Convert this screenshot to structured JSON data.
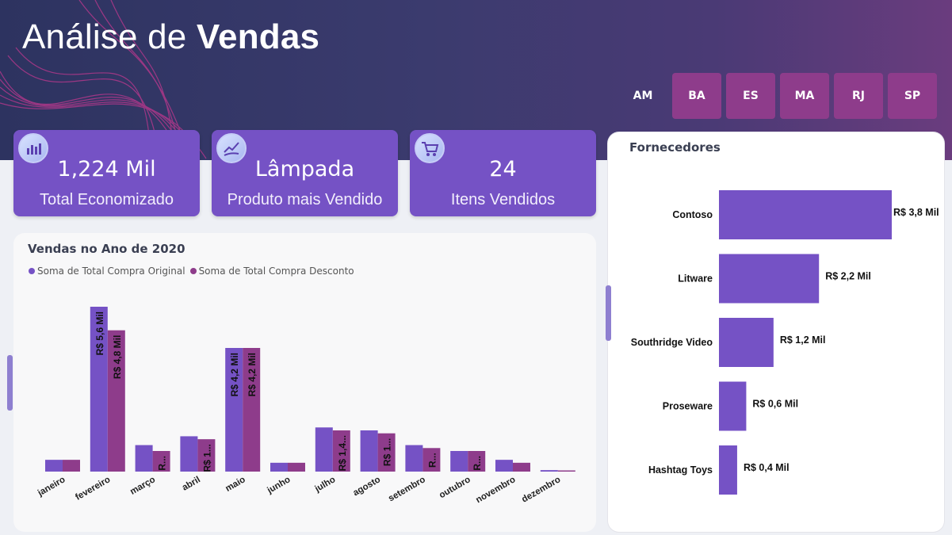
{
  "header": {
    "title_light": "Análise de ",
    "title_bold": "Vendas",
    "states": [
      {
        "label": "AM",
        "selected": false
      },
      {
        "label": "BA",
        "selected": true
      },
      {
        "label": "ES",
        "selected": true
      },
      {
        "label": "MA",
        "selected": true
      },
      {
        "label": "RJ",
        "selected": true
      },
      {
        "label": "SP",
        "selected": true
      }
    ]
  },
  "kpis": [
    {
      "value": "1,224 Mil",
      "label": "Total Economizado",
      "icon": "bar-chart-icon"
    },
    {
      "value": "Lâmpada",
      "label": "Produto mais Vendido",
      "icon": "trend-hand-icon"
    },
    {
      "value": "24",
      "label": "Itens Vendidos",
      "icon": "cart-icon"
    }
  ],
  "colors": {
    "original": "#7552c5",
    "desconto": "#8e3c8b",
    "bar_right": "#7552c5"
  },
  "chart_data": [
    {
      "type": "bar",
      "title": "Vendas no Ano de 2020",
      "categories": [
        "janeiro",
        "fevereiro",
        "março",
        "abril",
        "maio",
        "junho",
        "julho",
        "agosto",
        "setembro",
        "outubro",
        "novembro",
        "dezembro"
      ],
      "series": [
        {
          "name": "Soma de Total Compra Original",
          "values": [
            0.4,
            5.6,
            0.9,
            1.2,
            4.2,
            0.3,
            1.5,
            1.4,
            0.9,
            0.7,
            0.4,
            0.05
          ],
          "labels": [
            "",
            "R$ 5,6 Mil",
            "",
            "",
            "R$ 4,2 Mil",
            "",
            "",
            "",
            "",
            "",
            "",
            ""
          ]
        },
        {
          "name": "Soma de Total Compra Desconto",
          "values": [
            0.4,
            4.8,
            0.7,
            1.1,
            4.2,
            0.3,
            1.4,
            1.3,
            0.8,
            0.7,
            0.3,
            0.04
          ],
          "labels": [
            "",
            "R$ 4,8 Mil",
            "R...",
            "R$ 1...",
            "R$ 4,2 Mil",
            "",
            "R$ 1,4...",
            "R$ 1...",
            "R...",
            "R...",
            "",
            ""
          ]
        }
      ],
      "ylim": [
        0,
        5.6
      ]
    },
    {
      "type": "bar",
      "orientation": "horizontal",
      "title": "Fornecedores",
      "categories": [
        "Contoso",
        "Litware",
        "Southridge Video",
        "Proseware",
        "Hashtag Toys"
      ],
      "values": [
        3.8,
        2.2,
        1.2,
        0.6,
        0.4
      ],
      "labels": [
        "R$ 3,8 Mil",
        "R$ 2,2 Mil",
        "R$ 1,2 Mil",
        "R$ 0,6 Mil",
        "R$ 0,4 Mil"
      ],
      "xlim": [
        0,
        3.8
      ]
    }
  ]
}
